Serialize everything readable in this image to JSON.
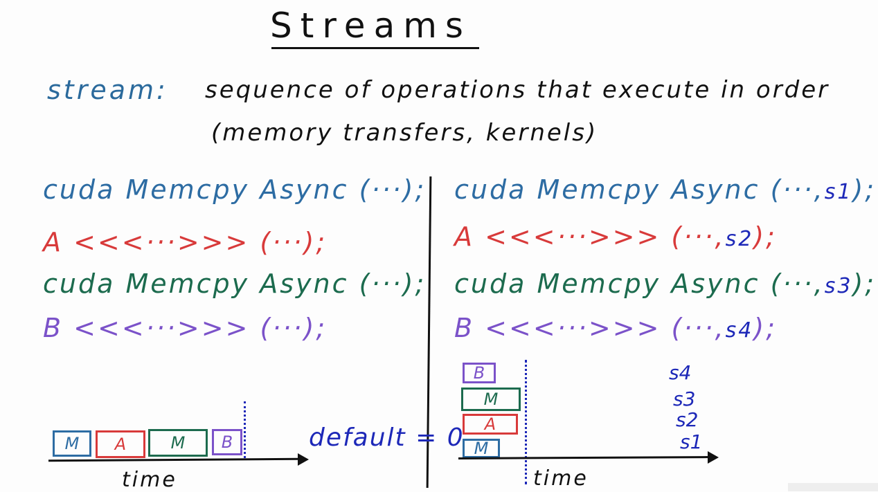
{
  "title": "Streams",
  "definition": {
    "term": "stream:",
    "text": "sequence of operations that execute in order",
    "subtext": "(memory transfers, kernels)"
  },
  "left_code": {
    "line1": "cuda Memcpy Async (···);",
    "line2": "A <<<···>>> (···);",
    "line3": "cuda Memcpy Async (···);",
    "line4": "B <<<···>>> (···);"
  },
  "right_code": {
    "line1_main": "cuda Memcpy Async (···,",
    "line1_stream": "s1",
    "line1_end": ");",
    "line2_main": "A <<<···>>> (···,",
    "line2_stream": "s2",
    "line2_end": ");",
    "line3_main": "cuda Memcpy Async (···,",
    "line3_stream": "s3",
    "line3_end": ");",
    "line4_main": "B <<<···>>> (···,",
    "line4_stream": "s4",
    "line4_end": ");"
  },
  "left_timeline": {
    "boxes": [
      "M",
      "A",
      "M",
      "B"
    ],
    "default_label": "default = 0",
    "axis_label": "time"
  },
  "right_timeline": {
    "boxes": [
      "B",
      "M",
      "A",
      "M"
    ],
    "streams": [
      "s4",
      "s3",
      "s2",
      "s1"
    ],
    "axis_label": "time"
  },
  "colors": {
    "memcpy": "#2d6ca3",
    "kernel_a": "#d83a3a",
    "memcpy_2": "#1c6b4e",
    "kernel_b": "#7b52c9",
    "stream_id": "#1d28b8"
  }
}
